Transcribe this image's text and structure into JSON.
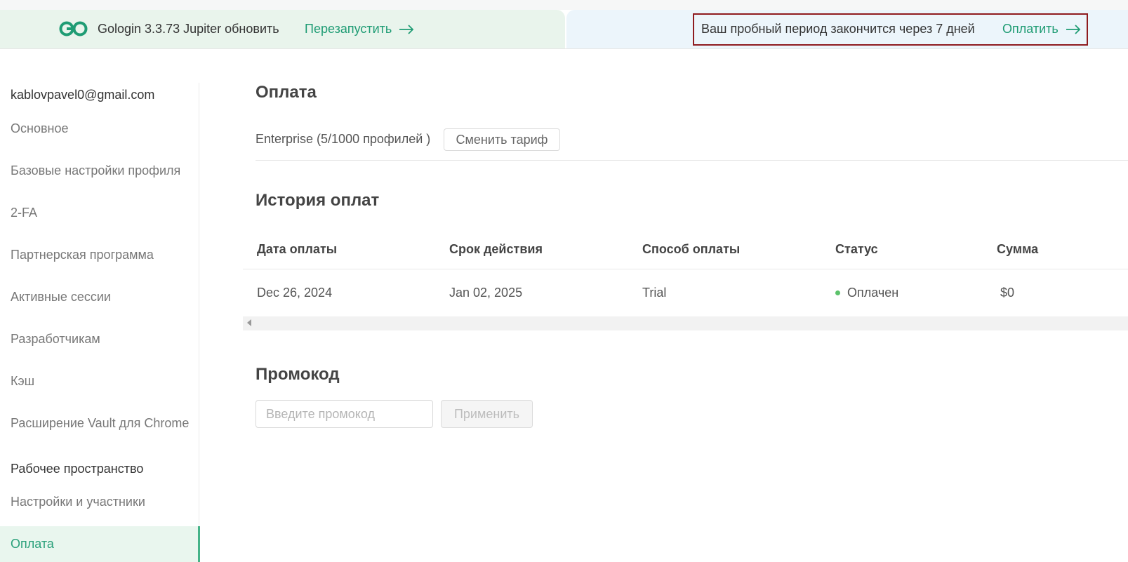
{
  "topbar": {
    "update_text": "Gologin 3.3.73 Jupiter обновить",
    "restart_label": "Перезапустить",
    "trial_text": "Ваш пробный период закончится через 7 дней",
    "pay_label": "Оплатить",
    "accent_color": "#1f9c74",
    "highlight_border_color": "#8e1b1f"
  },
  "sidebar": {
    "email": "kablovpavel0@gmail.com",
    "items": [
      {
        "label": "Основное"
      },
      {
        "label": "Базовые настройки профиля"
      },
      {
        "label": "2-FA"
      },
      {
        "label": "Партнерская программа"
      },
      {
        "label": "Активные сессии"
      },
      {
        "label": "Разработчикам"
      },
      {
        "label": "Кэш"
      },
      {
        "label": "Расширение Vault для Chrome"
      }
    ],
    "workspace_section": "Рабочее пространство",
    "workspace_items": [
      {
        "label": "Настройки и участники"
      }
    ],
    "active_item": "Оплата",
    "active_color": "#2aa07a"
  },
  "payment": {
    "title": "Оплата",
    "plan_label": "Enterprise (5/1000 профилей )",
    "change_plan_label": "Сменить тариф"
  },
  "history": {
    "title": "История оплат",
    "columns": [
      "Дата оплаты",
      "Срок действия",
      "Способ оплаты",
      "Статус",
      "Сумма"
    ],
    "rows": [
      {
        "date": "Dec 26, 2024",
        "expires": "Jan 02, 2025",
        "method": "Trial",
        "status": "Оплачен",
        "amount": "$0",
        "status_color": "#5cc26b"
      }
    ]
  },
  "promo": {
    "title": "Промокод",
    "placeholder": "Введите промокод",
    "apply_label": "Применить"
  }
}
